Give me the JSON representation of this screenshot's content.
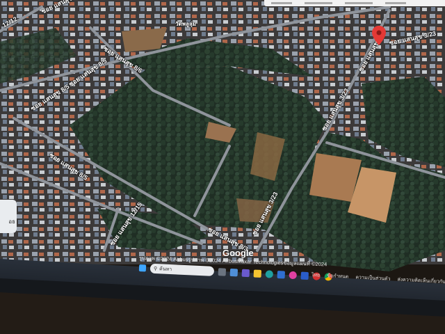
{
  "map": {
    "place_label": "วัดพลูลุ่ม",
    "road_labels": [
      "ซอย แสนสุข 8/5",
      "ซอย แสนสุข 8/6",
      "ซอย แสนสุข 8/5",
      "ซอย แสนสุข 8/5",
      "ซอย แสนสุข 3/23",
      "ซอย แสนสุข 3/23",
      "ซอย แสนสุข 3/23",
      "ซอย แสนสุข 8/3",
      "ซอย แสนสุข 12/15",
      "12/12",
      "ซอย แสนสุข"
    ],
    "google_logo": "Google",
    "side_control_text": "อธ"
  },
  "attribution": {
    "text": "รูปภาพ ©2024 Airbusรูปภาพ ©2024 AirbusMaxar Technologiesข้อมูลแผนที่ ©2024"
  },
  "footer_links": [
    "ไทย",
    "ข้อกำหนด",
    "ความเป็นส่วนตัว",
    "ส่งความคิดเห็นเกี่ยวกับ"
  ],
  "taskbar": {
    "search_placeholder": "ค้นหา",
    "icons": [
      "windows-start-icon",
      "search-icon",
      "task-view-icon",
      "widgets-icon",
      "file-explorer-icon",
      "edge-icon",
      "store-icon",
      "app-icon",
      "security-icon",
      "chrome-icon"
    ]
  },
  "colors": {
    "vegetation": "#243428",
    "road": "#8a8f96",
    "pin": "#e53935",
    "taskbar": "#222830"
  }
}
